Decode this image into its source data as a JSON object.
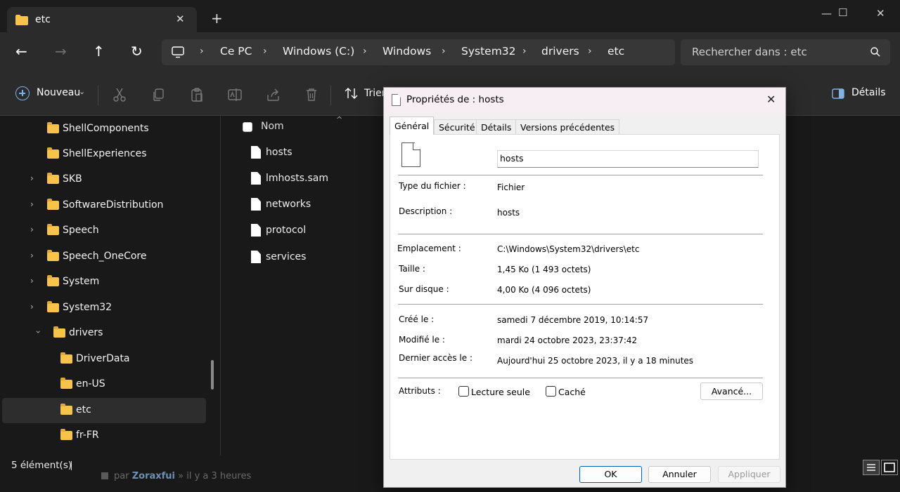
{
  "tab": {
    "title": "etc",
    "close": "✕",
    "newtab": "+"
  },
  "window_controls": {
    "minimize": "—",
    "maximize": "☐",
    "close": "✕"
  },
  "nav": {
    "back": "←",
    "forward": "→",
    "up": "↑",
    "refresh": "↻"
  },
  "breadcrumb": [
    "Ce PC",
    "Windows (C:)",
    "Windows",
    "System32",
    "drivers",
    "etc"
  ],
  "breadcrumb_sep": "›",
  "search": {
    "placeholder": "Rechercher dans : etc"
  },
  "commandbar": {
    "new_label": "Nouveau",
    "new_chevron": "⌄",
    "sort_label": "Trier",
    "details_label": "Détails"
  },
  "tree": [
    {
      "label": "ShellComponents",
      "expandable": false
    },
    {
      "label": "ShellExperiences",
      "expandable": false
    },
    {
      "label": "SKB",
      "expandable": true
    },
    {
      "label": "SoftwareDistribution",
      "expandable": true
    },
    {
      "label": "Speech",
      "expandable": true
    },
    {
      "label": "Speech_OneCore",
      "expandable": true
    },
    {
      "label": "System",
      "expandable": true
    },
    {
      "label": "System32",
      "expandable": true
    },
    {
      "label": "drivers",
      "expandable": true,
      "expanded": true
    },
    {
      "label": "DriverData",
      "expandable": false
    },
    {
      "label": "en-US",
      "expandable": false
    },
    {
      "label": "etc",
      "expandable": false,
      "selected": true
    },
    {
      "label": "fr-FR",
      "expandable": false
    }
  ],
  "filelist": {
    "column_name": "Nom",
    "files": [
      "hosts",
      "lmhosts.sam",
      "networks",
      "protocol",
      "services"
    ]
  },
  "status": {
    "count": "5 élément(s)"
  },
  "background_text": {
    "prefix": "par",
    "user": "Zoraxfui",
    "suffix": "» il y a 3 heures"
  },
  "dialog": {
    "title": "Propriétés de : hosts",
    "tabs": [
      "Général",
      "Sécurité",
      "Détails",
      "Versions précédentes"
    ],
    "filename": "hosts",
    "props": {
      "type_label": "Type du fichier :",
      "type_value": "Fichier",
      "desc_label": "Description :",
      "desc_value": "hosts",
      "location_label": "Emplacement :",
      "location_value": "C:\\Windows\\System32\\drivers\\etc",
      "size_label": "Taille :",
      "size_value": "1,45 Ko (1 493 octets)",
      "disk_label": "Sur disque :",
      "disk_value": "4,00 Ko (4 096 octets)",
      "created_label": "Créé le :",
      "created_value": "samedi 7 décembre 2019, 10:14:57",
      "modified_label": "Modifié le :",
      "modified_value": "mardi 24 octobre 2023, 23:37:42",
      "accessed_label": "Dernier accès le :",
      "accessed_value": "Aujourd'hui 25 octobre 2023, il y a 18 minutes",
      "attributes_label": "Attributs :",
      "readonly_label": "Lecture seule",
      "hidden_label": "Caché",
      "advanced_label": "Avancé..."
    },
    "buttons": {
      "ok": "OK",
      "cancel": "Annuler",
      "apply": "Appliquer"
    }
  }
}
